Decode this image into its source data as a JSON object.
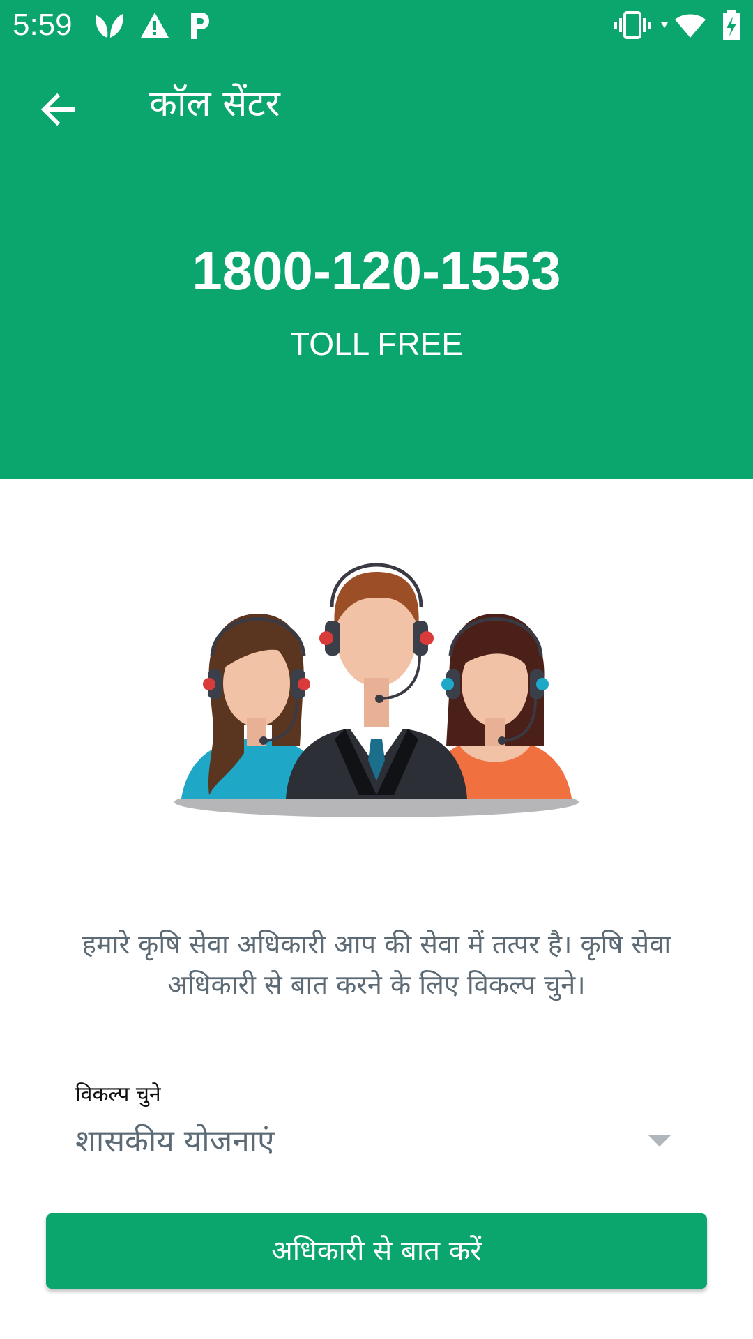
{
  "status_bar": {
    "time": "5:59",
    "icons_left": [
      "leaf-app-icon",
      "warning-icon",
      "p-app-icon"
    ],
    "icons_right": [
      "vibrate-icon",
      "wifi-icon",
      "battery-charging-icon"
    ]
  },
  "toolbar": {
    "title": "कॉल सेंटर",
    "back_icon": "arrow-back-icon"
  },
  "header": {
    "phone_number": "1800-120-1553",
    "subtitle": "TOLL FREE"
  },
  "main": {
    "illustration": "call-center-agents-illustration",
    "description": "हमारे कृषि सेवा अधिकारी आप की सेवा में तत्पर है। कृषि सेवा अधिकारी से बात करने के लिए विकल्प चुने।",
    "select": {
      "label": "विकल्प चुने",
      "value": "शासकीय योजनाएं"
    },
    "button_label": "अधिकारी से बात करें"
  },
  "colors": {
    "primary": "#0aa66e",
    "text_muted": "#5b6a74",
    "background": "#ffffff"
  }
}
